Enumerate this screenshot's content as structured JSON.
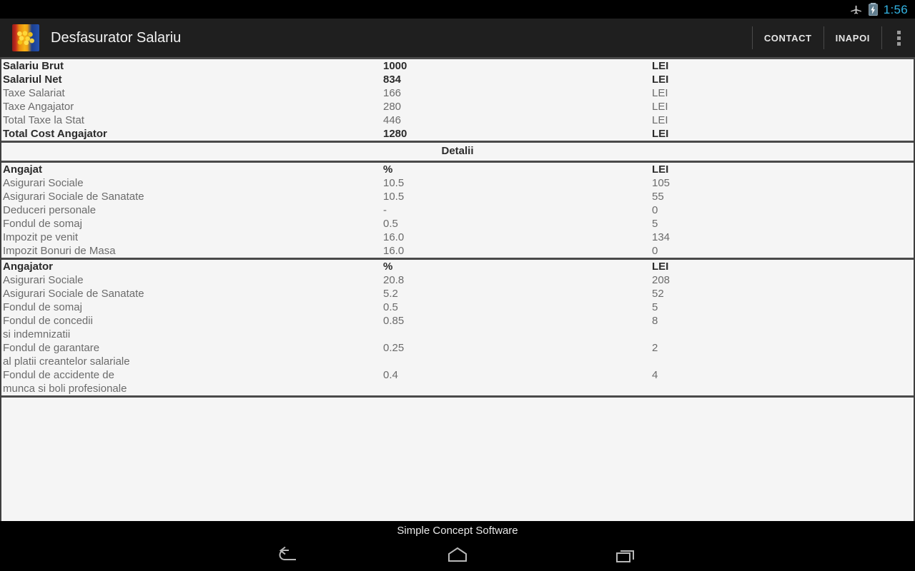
{
  "status_bar": {
    "airplane_icon": "airplane-mode-icon",
    "battery_icon": "battery-charging-icon",
    "clock": "1:56",
    "clock_color": "#33b5e5"
  },
  "action_bar": {
    "app_icon": "app-logo-romanian-flag-coins",
    "title": "Desfasurator Salariu",
    "actions": [
      {
        "label": "CONTACT",
        "name": "contact-action"
      },
      {
        "label": "INAPOI",
        "name": "back-action"
      }
    ],
    "overflow_icon": "overflow-menu-icon",
    "background": "#1f1f1f"
  },
  "summary": {
    "rows": [
      {
        "label": "Salariu Brut",
        "value": "1000",
        "currency": "LEI",
        "bold": true
      },
      {
        "label": "Salariul Net",
        "value": "834",
        "currency": "LEI",
        "bold": true
      },
      {
        "label": "Taxe Salariat",
        "value": "166",
        "currency": "LEI",
        "bold": false
      },
      {
        "label": "Taxe Angajator",
        "value": "280",
        "currency": "LEI",
        "bold": false
      },
      {
        "label": "Total Taxe la Stat",
        "value": "446",
        "currency": "LEI",
        "bold": false
      },
      {
        "label": "Total Cost Angajator",
        "value": "1280",
        "currency": "LEI",
        "bold": true
      }
    ]
  },
  "details": {
    "section_title": "Detalii",
    "employee": {
      "header": {
        "label": "Angajat",
        "pct": "%",
        "currency": "LEI"
      },
      "rows": [
        {
          "label": "Asigurari Sociale",
          "pct": "10.5",
          "amount": "105"
        },
        {
          "label": "Asigurari Sociale de Sanatate",
          "pct": "10.5",
          "amount": "55"
        },
        {
          "label": "Deduceri personale",
          "pct": "-",
          "amount": "0"
        },
        {
          "label": "Fondul de somaj",
          "pct": "0.5",
          "amount": "5"
        },
        {
          "label": "Impozit pe venit",
          "pct": "16.0",
          "amount": "134"
        },
        {
          "label": "Impozit Bonuri de Masa",
          "pct": "16.0",
          "amount": "0"
        }
      ]
    },
    "employer": {
      "header": {
        "label": "Angajator",
        "pct": "%",
        "currency": "LEI"
      },
      "rows": [
        {
          "label": "Asigurari Sociale",
          "pct": "20.8",
          "amount": "208"
        },
        {
          "label": "Asigurari Sociale de Sanatate",
          "pct": "5.2",
          "amount": "52"
        },
        {
          "label": "Fondul de somaj",
          "pct": "0.5",
          "amount": "5"
        },
        {
          "label": "Fondul de concedii\n si indemnizatii",
          "pct": "0.85",
          "amount": "8"
        },
        {
          "label": "Fondul de garantare\n al platii creantelor salariale",
          "pct": "0.25",
          "amount": "2"
        },
        {
          "label": "Fondul de accidente de\n munca si boli profesionale",
          "pct": "0.4",
          "amount": "4"
        }
      ]
    }
  },
  "footer": {
    "text": "Simple Concept Software"
  },
  "navbar": {
    "back": "back-nav-icon",
    "home": "home-nav-icon",
    "recents": "recent-apps-nav-icon"
  }
}
